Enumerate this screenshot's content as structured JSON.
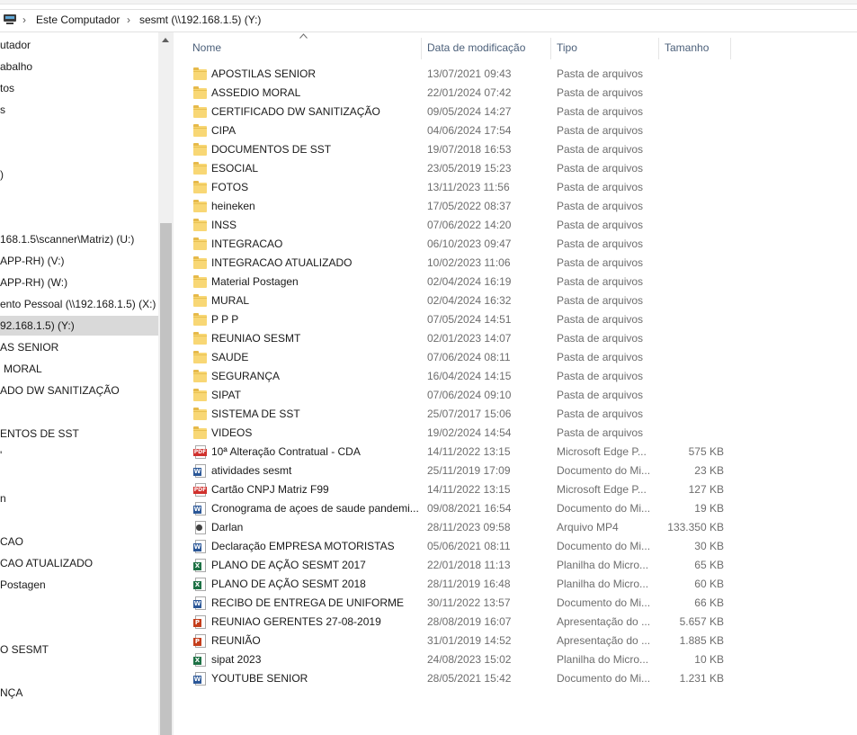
{
  "address_bar": {
    "crumbs": [
      "Este Computador",
      "sesmt (\\\\192.168.1.5) (Y:)"
    ]
  },
  "nav_pane": {
    "items": [
      {
        "label": "utador"
      },
      {
        "label": "abalho"
      },
      {
        "label": "tos"
      },
      {
        "label": "s"
      },
      {
        "label": ")"
      },
      {
        "label": "168.1.5\\scanner\\Matriz) (U:)"
      },
      {
        "label": "APP-RH) (V:)"
      },
      {
        "label": "APP-RH) (W:)"
      },
      {
        "label": "ento Pessoal (\\\\192.168.1.5) (X:)"
      },
      {
        "label": "92.168.1.5) (Y:)",
        "selected": true
      },
      {
        "label": "AS SENIOR"
      },
      {
        "label": "MORAL"
      },
      {
        "label": "ADO DW SANITIZAÇÃO"
      },
      {
        "label": "ENTOS DE SST"
      },
      {
        "label": "'"
      },
      {
        "label": "n"
      },
      {
        "label": "CAO"
      },
      {
        "label": "CAO ATUALIZADO"
      },
      {
        "label": "Postagen"
      },
      {
        "label": "O SESMT"
      },
      {
        "label": "NÇA"
      }
    ]
  },
  "columns": {
    "name": "Nome",
    "date": "Data de modificação",
    "type": "Tipo",
    "size": "Tamanho"
  },
  "files": [
    {
      "icon": "folder-icon",
      "name": "APOSTILAS SENIOR",
      "date": "13/07/2021 09:43",
      "type": "Pasta de arquivos",
      "size": ""
    },
    {
      "icon": "folder-icon",
      "name": "ASSEDIO MORAL",
      "date": "22/01/2024 07:42",
      "type": "Pasta de arquivos",
      "size": ""
    },
    {
      "icon": "folder-icon",
      "name": "CERTIFICADO DW SANITIZAÇÃO",
      "date": "09/05/2024 14:27",
      "type": "Pasta de arquivos",
      "size": ""
    },
    {
      "icon": "folder-icon",
      "name": "CIPA",
      "date": "04/06/2024 17:54",
      "type": "Pasta de arquivos",
      "size": ""
    },
    {
      "icon": "folder-icon",
      "name": "DOCUMENTOS DE SST",
      "date": "19/07/2018 16:53",
      "type": "Pasta de arquivos",
      "size": ""
    },
    {
      "icon": "folder-icon",
      "name": "ESOCIAL",
      "date": "23/05/2019 15:23",
      "type": "Pasta de arquivos",
      "size": ""
    },
    {
      "icon": "folder-icon",
      "name": "FOTOS",
      "date": "13/11/2023 11:56",
      "type": "Pasta de arquivos",
      "size": ""
    },
    {
      "icon": "folder-icon",
      "name": "heineken",
      "date": "17/05/2022 08:37",
      "type": "Pasta de arquivos",
      "size": ""
    },
    {
      "icon": "folder-icon",
      "name": "INSS",
      "date": "07/06/2022 14:20",
      "type": "Pasta de arquivos",
      "size": ""
    },
    {
      "icon": "folder-icon",
      "name": "INTEGRACAO",
      "date": "06/10/2023 09:47",
      "type": "Pasta de arquivos",
      "size": ""
    },
    {
      "icon": "folder-icon",
      "name": "INTEGRACAO ATUALIZADO",
      "date": "10/02/2023 11:06",
      "type": "Pasta de arquivos",
      "size": ""
    },
    {
      "icon": "folder-icon",
      "name": "Material Postagen",
      "date": "02/04/2024 16:19",
      "type": "Pasta de arquivos",
      "size": ""
    },
    {
      "icon": "folder-icon",
      "name": "MURAL",
      "date": "02/04/2024 16:32",
      "type": "Pasta de arquivos",
      "size": ""
    },
    {
      "icon": "folder-icon",
      "name": "P P P",
      "date": "07/05/2024 14:51",
      "type": "Pasta de arquivos",
      "size": ""
    },
    {
      "icon": "folder-icon",
      "name": "REUNIAO SESMT",
      "date": "02/01/2023 14:07",
      "type": "Pasta de arquivos",
      "size": ""
    },
    {
      "icon": "folder-icon",
      "name": "SAUDE",
      "date": "07/06/2024 08:11",
      "type": "Pasta de arquivos",
      "size": ""
    },
    {
      "icon": "folder-icon",
      "name": "SEGURANÇA",
      "date": "16/04/2024 14:15",
      "type": "Pasta de arquivos",
      "size": ""
    },
    {
      "icon": "folder-icon",
      "name": "SIPAT",
      "date": "07/06/2024 09:10",
      "type": "Pasta de arquivos",
      "size": ""
    },
    {
      "icon": "folder-icon",
      "name": "SISTEMA DE SST",
      "date": "25/07/2017 15:06",
      "type": "Pasta de arquivos",
      "size": ""
    },
    {
      "icon": "folder-icon",
      "name": "VIDEOS",
      "date": "19/02/2024 14:54",
      "type": "Pasta de arquivos",
      "size": ""
    },
    {
      "icon": "pdf-icon",
      "name": "10ª Alteração Contratual - CDA",
      "date": "14/11/2022 13:15",
      "type": "Microsoft Edge P...",
      "size": "575 KB"
    },
    {
      "icon": "word-icon",
      "name": "atividades sesmt",
      "date": "25/11/2019 17:09",
      "type": "Documento do Mi...",
      "size": "23 KB"
    },
    {
      "icon": "pdf-icon",
      "name": "Cartão CNPJ Matriz F99",
      "date": "14/11/2022 13:15",
      "type": "Microsoft Edge P...",
      "size": "127 KB"
    },
    {
      "icon": "word-icon",
      "name": "Cronograma de açoes de saude pandemi...",
      "date": "09/08/2021 16:54",
      "type": "Documento do Mi...",
      "size": "19 KB"
    },
    {
      "icon": "video-icon",
      "name": "Darlan",
      "date": "28/11/2023 09:58",
      "type": "Arquivo MP4",
      "size": "133.350 KB"
    },
    {
      "icon": "word-icon",
      "name": "Declaração EMPRESA MOTORISTAS",
      "date": "05/06/2021 08:11",
      "type": "Documento do Mi...",
      "size": "30 KB"
    },
    {
      "icon": "excel-icon",
      "name": "PLANO DE AÇÃO SESMT 2017",
      "date": "22/01/2018 11:13",
      "type": "Planilha do Micro...",
      "size": "65 KB"
    },
    {
      "icon": "excel-icon",
      "name": "PLANO DE AÇÃO SESMT 2018",
      "date": "28/11/2019 16:48",
      "type": "Planilha do Micro...",
      "size": "60 KB"
    },
    {
      "icon": "word-icon",
      "name": "RECIBO DE ENTREGA DE UNIFORME",
      "date": "30/11/2022 13:57",
      "type": "Documento do Mi...",
      "size": "66 KB"
    },
    {
      "icon": "powerpoint-icon",
      "name": "REUNIAO GERENTES 27-08-2019",
      "date": "28/08/2019 16:07",
      "type": "Apresentação do ...",
      "size": "5.657 KB"
    },
    {
      "icon": "powerpoint-icon",
      "name": "REUNIÃO",
      "date": "31/01/2019 14:52",
      "type": "Apresentação do ...",
      "size": "1.885 KB"
    },
    {
      "icon": "excel-icon",
      "name": "sipat 2023",
      "date": "24/08/2023 15:02",
      "type": "Planilha do Micro...",
      "size": "10 KB"
    },
    {
      "icon": "word-icon",
      "name": "YOUTUBE SENIOR",
      "date": "28/05/2021 15:42",
      "type": "Documento do Mi...",
      "size": "1.231 KB"
    }
  ]
}
